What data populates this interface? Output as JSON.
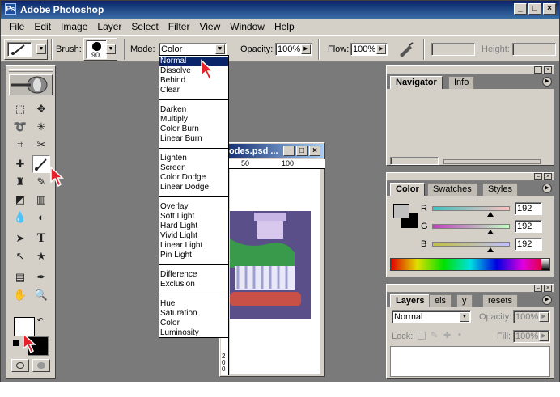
{
  "app": {
    "title": "Adobe Photoshop",
    "icon": "photoshop-icon",
    "window_buttons": [
      "_",
      "□",
      "×"
    ]
  },
  "menu": [
    "File",
    "Edit",
    "Image",
    "Layer",
    "Select",
    "Filter",
    "View",
    "Window",
    "Help"
  ],
  "options_bar": {
    "brush_label": "Brush:",
    "brush_size": "90",
    "mode_label": "Mode:",
    "mode_value": "Color",
    "opacity_label": "Opacity:",
    "opacity_value": "100%",
    "flow_label": "Flow:",
    "flow_value": "100%",
    "height_label": "Height:"
  },
  "blend_modes": {
    "groups": [
      [
        "Normal",
        "Dissolve",
        "Behind",
        "Clear"
      ],
      [
        "Darken",
        "Multiply",
        "Color Burn",
        "Linear Burn"
      ],
      [
        "Lighten",
        "Screen",
        "Color Dodge",
        "Linear Dodge"
      ],
      [
        "Overlay",
        "Soft Light",
        "Hard Light",
        "Vivid Light",
        "Linear Light",
        "Pin Light"
      ],
      [
        "Difference",
        "Exclusion"
      ],
      [
        "Hue",
        "Saturation",
        "Color",
        "Luminosity"
      ]
    ],
    "highlighted": "Normal"
  },
  "document": {
    "title": "odes.psd ...",
    "ruler_labels": [
      "50",
      "100"
    ],
    "vruler_label": "200"
  },
  "panels": {
    "navigator": {
      "tabs": [
        "Navigator",
        "Info"
      ]
    },
    "color": {
      "tabs": [
        "Color",
        "Swatches",
        "Styles"
      ],
      "channels": [
        {
          "label": "R",
          "value": "192",
          "level": 0.75
        },
        {
          "label": "G",
          "value": "192",
          "level": 0.75
        },
        {
          "label": "B",
          "value": "192",
          "level": 0.75
        }
      ]
    },
    "layers": {
      "tabs": [
        "Layers",
        "els",
        "y",
        "resets"
      ],
      "blend_value": "Normal",
      "opacity_label": "Opacity:",
      "opacity_value": "100%",
      "lock_label": "Lock:",
      "fill_label": "Fill:",
      "fill_value": "100%"
    }
  },
  "colors": {
    "accent": "#0a246a",
    "chrome": "#d4d0c8",
    "workspace": "#7a7a7a",
    "pointer": "#e8202a"
  }
}
